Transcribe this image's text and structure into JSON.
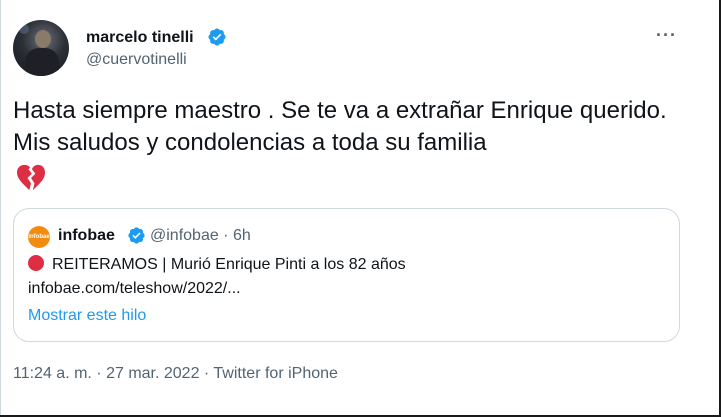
{
  "author": {
    "name": "marcelo tinelli",
    "handle": "@cuervotinelli"
  },
  "menu": {
    "more_label": "···"
  },
  "tweet": {
    "text": "Hasta siempre maestro . Se te va a extrañar Enrique querido. Mis saludos y condolencias a toda su familia",
    "emoji": "broken-heart-icon"
  },
  "quote": {
    "logo_text": "infobae",
    "name": "infobae",
    "handle_time": "@infobae · 6h",
    "line1": "REITERAMOS | Murió Enrique Pinti a los 82 años",
    "line2": "infobae.com/teleshow/2022/...",
    "show_thread": "Mostrar este hilo"
  },
  "meta": {
    "timestamp": "11:24 a. m. · 27 mar. 2022 · Twitter for iPhone"
  },
  "colors": {
    "verified": "#1d9bf0",
    "link": "#1d9bf0",
    "secondary_text": "#536471",
    "infobae_orange": "#f28b10",
    "red_dot": "#dd2e44"
  }
}
